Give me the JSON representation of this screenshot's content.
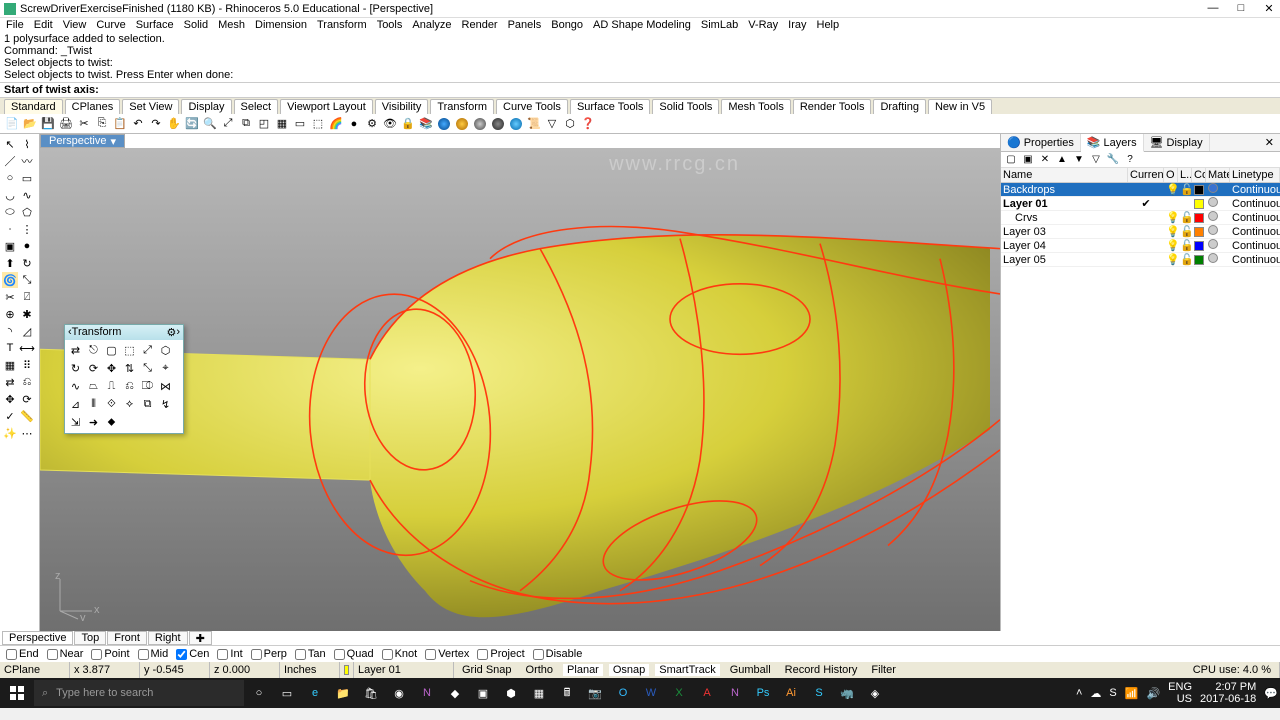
{
  "window": {
    "title": "ScrewDriverExerciseFinished (1180 KB) - Rhinoceros 5.0 Educational - [Perspective]"
  },
  "menu": [
    "File",
    "Edit",
    "View",
    "Curve",
    "Surface",
    "Solid",
    "Mesh",
    "Dimension",
    "Transform",
    "Tools",
    "Analyze",
    "Render",
    "Panels",
    "Bongo",
    "AD Shape Modeling",
    "SimLab",
    "V-Ray",
    "Iray",
    "Help"
  ],
  "command_history": [
    "1 polysurface added to selection.",
    "Command: _Twist",
    "Select objects to twist:",
    "Select objects to twist. Press Enter when done:"
  ],
  "command_prompt": {
    "label": "Start of twist axis:"
  },
  "toolbar_tabs": [
    "Standard",
    "CPlanes",
    "Set View",
    "Display",
    "Select",
    "Viewport Layout",
    "Visibility",
    "Transform",
    "Curve Tools",
    "Surface Tools",
    "Solid Tools",
    "Mesh Tools",
    "Render Tools",
    "Drafting",
    "New in V5"
  ],
  "viewport_tab": "Perspective",
  "floating_panel": {
    "title": "Transform"
  },
  "right_panel": {
    "tabs": [
      "Properties",
      "Layers",
      "Display"
    ],
    "active_tab": "Layers",
    "columns": [
      "Name",
      "Current",
      "O",
      "L...",
      "Co...",
      "Material",
      "Linetype"
    ],
    "rows": [
      {
        "name": "Backdrops",
        "current": "",
        "on": "💡",
        "lock": "🔓",
        "color": "#000000",
        "material": "blue",
        "linetype": "Continuous",
        "selected": true
      },
      {
        "name": "Layer 01",
        "current": "✔",
        "on": "",
        "lock": "",
        "color": "#ffff00",
        "material": "",
        "linetype": "Continuous",
        "selected": false,
        "bold": true
      },
      {
        "name": "Crvs",
        "current": "",
        "on": "💡",
        "lock": "🔓",
        "color": "#ff0000",
        "material": "",
        "linetype": "Continuous",
        "selected": false,
        "indent": true
      },
      {
        "name": "Layer 03",
        "current": "",
        "on": "💡",
        "lock": "🔓",
        "color": "#ff8000",
        "material": "",
        "linetype": "Continuous",
        "selected": false
      },
      {
        "name": "Layer 04",
        "current": "",
        "on": "💡",
        "lock": "🔓",
        "color": "#0000ff",
        "material": "",
        "linetype": "Continuous",
        "selected": false
      },
      {
        "name": "Layer 05",
        "current": "",
        "on": "💡",
        "lock": "🔓",
        "color": "#008000",
        "material": "",
        "linetype": "Continuous",
        "selected": false
      }
    ]
  },
  "viewport_tabs_bottom": [
    "Perspective",
    "Top",
    "Front",
    "Right"
  ],
  "osnaps": [
    {
      "label": "End",
      "checked": false
    },
    {
      "label": "Near",
      "checked": false
    },
    {
      "label": "Point",
      "checked": false
    },
    {
      "label": "Mid",
      "checked": false
    },
    {
      "label": "Cen",
      "checked": true
    },
    {
      "label": "Int",
      "checked": false
    },
    {
      "label": "Perp",
      "checked": false
    },
    {
      "label": "Tan",
      "checked": false
    },
    {
      "label": "Quad",
      "checked": false
    },
    {
      "label": "Knot",
      "checked": false
    },
    {
      "label": "Vertex",
      "checked": false
    },
    {
      "label": "Project",
      "checked": false
    },
    {
      "label": "Disable",
      "checked": false
    }
  ],
  "status": {
    "cplane": "CPlane",
    "x": "x 3.877",
    "y": "y -0.545",
    "z": "z 0.000",
    "units": "Inches",
    "layer": "Layer 01",
    "flags": [
      {
        "t": "Grid Snap",
        "on": false
      },
      {
        "t": "Ortho",
        "on": false
      },
      {
        "t": "Planar",
        "on": true
      },
      {
        "t": "Osnap",
        "on": true
      },
      {
        "t": "SmartTrack",
        "on": true
      },
      {
        "t": "Gumball",
        "on": false
      },
      {
        "t": "Record History",
        "on": false
      },
      {
        "t": "Filter",
        "on": false
      }
    ],
    "cpu": "CPU use: 4.0 %"
  },
  "taskbar": {
    "search_placeholder": "Type here to search",
    "clock1": "2:07 PM",
    "clock2": "2017-06-18",
    "lang": "ENG",
    "region": "US"
  },
  "watermark": "www.rrcg.cn"
}
